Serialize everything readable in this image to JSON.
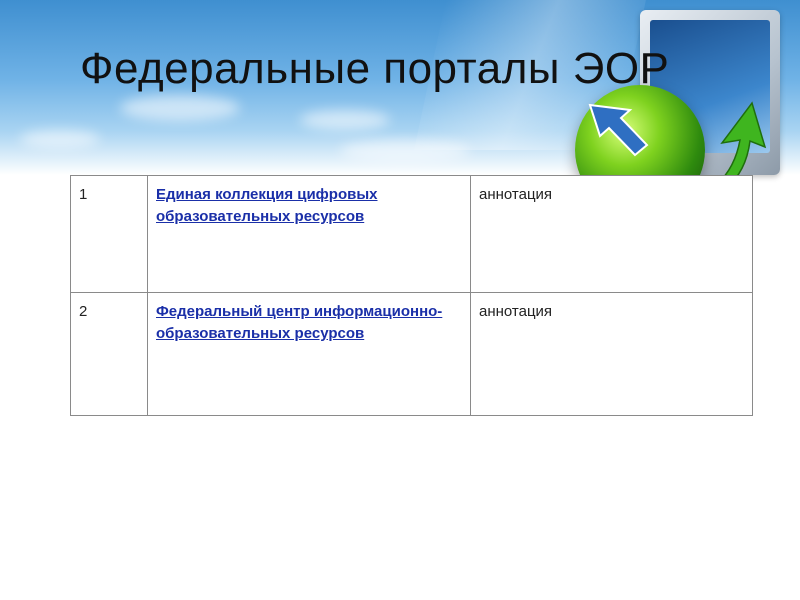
{
  "slide": {
    "title": "Федеральные порталы ЭОР"
  },
  "table": {
    "rows": [
      {
        "number": "1",
        "link": "Единая коллекция цифровых образовательных ресурсов",
        "annotation": "аннотация"
      },
      {
        "number": "2",
        "link": "Федеральный центр информационно-образовательных ресурсов",
        "annotation": "аннотация"
      }
    ]
  },
  "colors": {
    "link": "#1a2fa8",
    "banner_top": "#3f8fd0",
    "globe": "#7fd21f"
  }
}
